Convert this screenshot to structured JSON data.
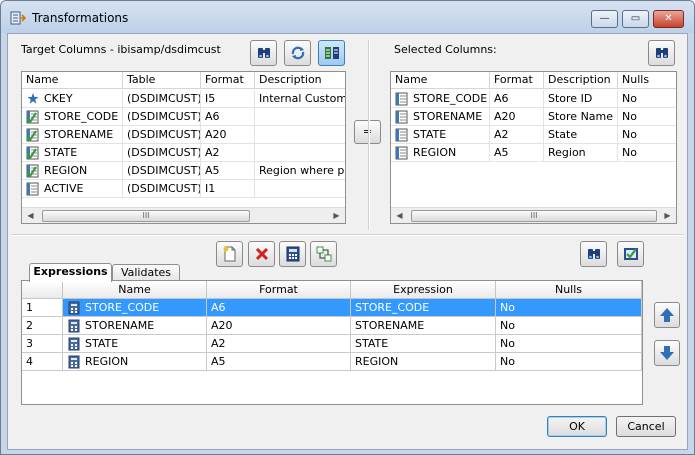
{
  "window": {
    "title": "Transformations",
    "min_glyph": "—",
    "max_glyph": "▭",
    "close_glyph": "✕"
  },
  "target": {
    "label": "Target Columns - ibisamp/dsdimcust",
    "columns": [
      "Name",
      "Table",
      "Format",
      "Description"
    ],
    "rows": [
      {
        "icon": "key-star-icon",
        "name": "CKEY",
        "table": "(DSDIMCUST)",
        "format": "I5",
        "description": "Internal Custome"
      },
      {
        "icon": "checked-column-icon",
        "name": "STORE_CODE",
        "table": "(DSDIMCUST)",
        "format": "A6",
        "description": ""
      },
      {
        "icon": "checked-column-icon",
        "name": "STORENAME",
        "table": "(DSDIMCUST)",
        "format": "A20",
        "description": ""
      },
      {
        "icon": "checked-column-icon",
        "name": "STATE",
        "table": "(DSDIMCUST)",
        "format": "A2",
        "description": ""
      },
      {
        "icon": "checked-column-icon",
        "name": "REGION",
        "table": "(DSDIMCUST)",
        "format": "A5",
        "description": "Region where pro"
      },
      {
        "icon": "column-icon",
        "name": "ACTIVE",
        "table": "(DSDIMCUST)",
        "format": "I1",
        "description": ""
      }
    ]
  },
  "selected": {
    "label": "Selected Columns:",
    "columns": [
      "Name",
      "Format",
      "Description",
      "Nulls"
    ],
    "rows": [
      {
        "name": "STORE_CODE",
        "format": "A6",
        "description": "Store ID",
        "nulls": "No"
      },
      {
        "name": "STORENAME",
        "format": "A20",
        "description": "Store Name",
        "nulls": "No"
      },
      {
        "name": "STATE",
        "format": "A2",
        "description": "State",
        "nulls": "No"
      },
      {
        "name": "REGION",
        "format": "A5",
        "description": "Region",
        "nulls": "No"
      }
    ]
  },
  "equals_label": "=",
  "scroll_grip": "III",
  "tabs": [
    "Expressions",
    "Validates"
  ],
  "expressions": {
    "columns": [
      "Name",
      "Format",
      "Expression",
      "Nulls"
    ],
    "rows": [
      {
        "num": "1",
        "name": "STORE_CODE",
        "format": "A6",
        "expression": "STORE_CODE",
        "nulls": "No"
      },
      {
        "num": "2",
        "name": "STORENAME",
        "format": "A20",
        "expression": "STORENAME",
        "nulls": "No"
      },
      {
        "num": "3",
        "name": "STATE",
        "format": "A2",
        "expression": "STATE",
        "nulls": "No"
      },
      {
        "num": "4",
        "name": "REGION",
        "format": "A5",
        "expression": "REGION",
        "nulls": "No"
      }
    ]
  },
  "buttons": {
    "ok": "OK",
    "cancel": "Cancel"
  },
  "colors": {
    "selection": "#3399ff",
    "accent": "#2f6fb5",
    "delete_red": "#d42020",
    "check_green": "#3a9a3a"
  }
}
